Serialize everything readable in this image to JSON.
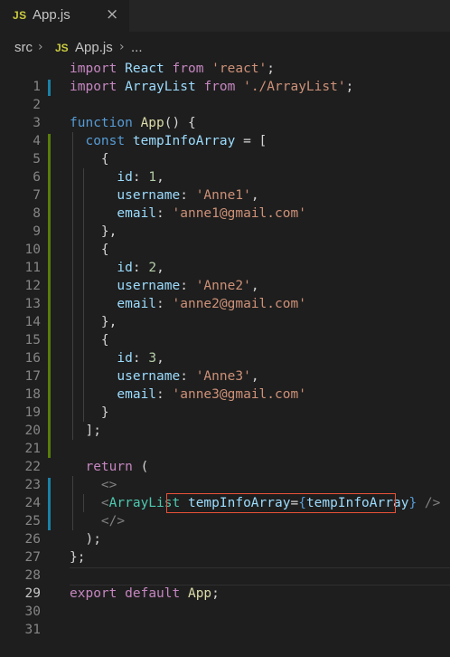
{
  "tab": {
    "badge": "JS",
    "title": "App.js",
    "close": "×"
  },
  "breadcrumb": {
    "folder": "src",
    "sep1": "›",
    "badge": "JS",
    "file": "App.js",
    "sep2": "›",
    "ellipsis": "..."
  },
  "colors": {
    "background": "#1e1e1e",
    "tab_bar": "#252526",
    "gutter_modified": "#1b81a8",
    "gutter_added": "#587c0c",
    "highlight_box": "#e8523a"
  },
  "editor": {
    "line_numbers": [
      "1",
      "2",
      "3",
      "4",
      "5",
      "6",
      "7",
      "8",
      "9",
      "10",
      "11",
      "12",
      "13",
      "14",
      "15",
      "16",
      "17",
      "18",
      "19",
      "20",
      "21",
      "22",
      "23",
      "24",
      "25",
      "26",
      "27",
      "28",
      "29",
      "30",
      "31"
    ],
    "current_line": "29",
    "lines": {
      "l1": [
        "import",
        "React",
        "from",
        "'react'",
        ";"
      ],
      "l2": [
        "import",
        "ArrayList",
        "from",
        "'./ArrayList'",
        ";"
      ],
      "l4": [
        "function",
        "App",
        "() {"
      ],
      "l5": [
        "const",
        "tempInfoArray",
        " = ["
      ],
      "l6": [
        "{"
      ],
      "l7": [
        "id",
        ": ",
        "1",
        ","
      ],
      "l8": [
        "username",
        ": ",
        "'Anne1'",
        ","
      ],
      "l9": [
        "email",
        ": ",
        "'anne1@gmail.com'"
      ],
      "l10": [
        "},"
      ],
      "l11": [
        "{"
      ],
      "l12": [
        "id",
        ": ",
        "2",
        ","
      ],
      "l13": [
        "username",
        ": ",
        "'Anne2'",
        ","
      ],
      "l14": [
        "email",
        ": ",
        "'anne2@gmail.com'"
      ],
      "l15": [
        "},"
      ],
      "l16": [
        "{"
      ],
      "l17": [
        "id",
        ": ",
        "3",
        ","
      ],
      "l18": [
        "username",
        ": ",
        "'Anne3'",
        ","
      ],
      "l19": [
        "email",
        ": ",
        "'anne3@gmail.com'"
      ],
      "l20": [
        "}"
      ],
      "l21": [
        "];"
      ],
      "l23": [
        "return",
        " ("
      ],
      "l24": [
        "<>"
      ],
      "l25": [
        "<",
        "ArrayList",
        "tempInfoArray",
        "=",
        "{",
        "tempInfoArray",
        "}",
        " />"
      ],
      "l26": [
        "</>"
      ],
      "l27": [
        ");"
      ],
      "l28": [
        "};"
      ],
      "l30": [
        "export",
        "default",
        "App",
        ";"
      ]
    }
  }
}
